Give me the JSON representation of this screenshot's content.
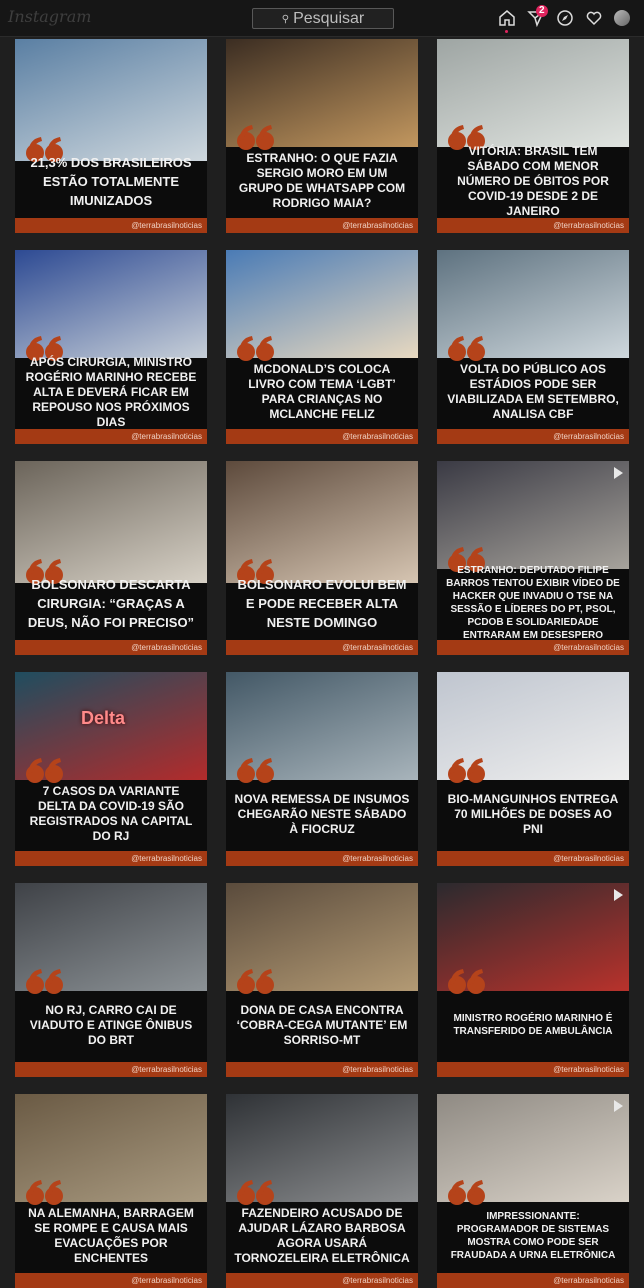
{
  "header": {
    "logo": "Instagram",
    "search_placeholder": "Pesquisar",
    "notification_count": "2"
  },
  "posts": [
    {
      "headline": "21,3% dos brasileiros estão totalmente imunizados",
      "handle": "@terrabrasilnoticias",
      "size": "big",
      "photo": "syringe-photo",
      "colors": [
        "#5a7fa3",
        "#cfd8de"
      ]
    },
    {
      "headline": "Estranho: O que fazia Sergio Moro em um grupo de WhatsApp com Rodrigo Maia?",
      "handle": "@terrabrasilnoticias",
      "size": "",
      "photo": "moro-maia-photo",
      "colors": [
        "#3b2d22",
        "#c2975f"
      ]
    },
    {
      "headline": "Vitória: Brasil tem sábado com menor número de óbitos por Covid-19 desde 2 de janeiro",
      "handle": "@terrabrasilnoticias",
      "size": "",
      "photo": "hospital-ward-photo",
      "colors": [
        "#9ea5a3",
        "#e0e4e0"
      ]
    },
    {
      "headline": "Após cirurgia, ministro Rogério Marinho recebe alta e deverá ficar em repouso nos próximos dias",
      "handle": "@terrabrasilnoticias",
      "size": "",
      "photo": "minister-podium-photo",
      "colors": [
        "#2d4a93",
        "#c7cfd8"
      ]
    },
    {
      "headline": "McDonald’s coloca livro com tema ‘LGBT’ para crianças no McLanche Feliz",
      "handle": "@terrabrasilnoticias",
      "size": "",
      "photo": "rainbow-hands-photo",
      "colors": [
        "#4a7bb5",
        "#e8d9c0"
      ]
    },
    {
      "headline": "Volta do público aos estádios pode ser viabilizada em setembro, analisa CBF",
      "handle": "@terrabrasilnoticias",
      "size": "",
      "photo": "stadium-photo",
      "colors": [
        "#5e7280",
        "#cfd8dd"
      ]
    },
    {
      "headline": "Bolsonaro descarta cirurgia: “graças a Deus, não foi preciso”",
      "handle": "@terrabrasilnoticias",
      "size": "big",
      "photo": "hospital-bed-photo",
      "colors": [
        "#6b645a",
        "#d7d1c6"
      ]
    },
    {
      "headline": "Bolsonaro evolui bem e pode receber alta neste domingo",
      "handle": "@terrabrasilnoticias",
      "size": "big",
      "photo": "bolsonaro-smile-photo",
      "colors": [
        "#5d4a3c",
        "#d6c5b2"
      ]
    },
    {
      "headline": "Estranho: Deputado Filipe Barros tentou exibir vídeo de hacker que invadiu o TSE na sessão e líderes do PT, PSOL, PCdoB e Solidariedade entraram em desespero",
      "handle": "@terrabrasilnoticias",
      "size": "small",
      "photo": "video-call-photo",
      "colors": [
        "#3a3a44",
        "#a7a39c"
      ],
      "video": true
    },
    {
      "headline": "7 casos da variante Delta da Covid-19 são registrados na capital do RJ",
      "handle": "@terrabrasilnoticias",
      "size": "",
      "photo": "delta-virus-photo",
      "colors": [
        "#1f4d5f",
        "#b32b2b"
      ],
      "overlay_text": "Delta"
    },
    {
      "headline": "Nova remessa de insumos chegarão neste sábado à Fiocruz",
      "handle": "@terrabrasilnoticias",
      "size": "",
      "photo": "vaccine-vials-photo",
      "colors": [
        "#435866",
        "#a8b4bb"
      ]
    },
    {
      "headline": "Bio-Manguinhos entrega 70 milhões de doses ao PNI",
      "handle": "@terrabrasilnoticias",
      "size": "",
      "photo": "astrazeneca-vial-photo",
      "colors": [
        "#bfc5cf",
        "#eeeeee"
      ]
    },
    {
      "headline": "No RJ, carro cai de viaduto e atinge ônibus do BRT",
      "handle": "@terrabrasilnoticias",
      "size": "",
      "photo": "car-crash-photo",
      "colors": [
        "#3f4247",
        "#8c9296"
      ]
    },
    {
      "headline": "Dona de casa encontra ‘cobra-cega mutante’ em Sorriso-MT",
      "handle": "@terrabrasilnoticias",
      "size": "",
      "photo": "worm-photo",
      "colors": [
        "#5a4b3c",
        "#b39a74"
      ]
    },
    {
      "headline": "Ministro Rogério Marinho é transferido de ambulância",
      "handle": "@terrabrasilnoticias",
      "size": "small",
      "photo": "ambulance-photo",
      "colors": [
        "#2b2a2e",
        "#b8322c"
      ],
      "video": true
    },
    {
      "headline": "Na Alemanha, barragem se rompe e causa mais evacuações por enchentes",
      "handle": "@terrabrasilnoticias",
      "size": "",
      "photo": "flood-photo",
      "colors": [
        "#6a5a44",
        "#a99a80"
      ]
    },
    {
      "headline": "Fazendeiro acusado de ajudar Lázaro Barbosa agora usará tornozeleira eletrônica",
      "handle": "@terrabrasilnoticias",
      "size": "",
      "photo": "police-photo",
      "colors": [
        "#2f3236",
        "#8b8d8f"
      ]
    },
    {
      "headline": "Impressionante: Programador de sistemas mostra como pode ser fraudada a urna eletrônica",
      "handle": "@terrabrasilnoticias",
      "size": "small",
      "photo": "programmer-photo",
      "colors": [
        "#8f8a83",
        "#d9d2c8"
      ],
      "video": true
    }
  ]
}
